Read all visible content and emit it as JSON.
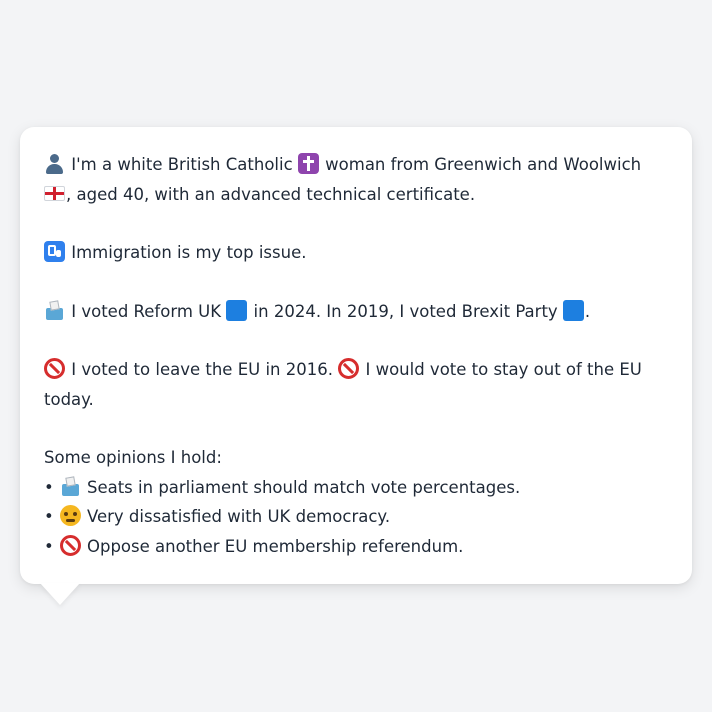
{
  "profile": {
    "intro": {
      "icon": "person-icon",
      "text_1": " I'm a white British Catholic ",
      "icon_religion": "latin-cross-icon",
      "text_2": " woman from Greenwich and Woolwich ",
      "icon_flag": "england-flag-icon",
      "text_3": ", aged 40, with an advanced technical certificate."
    },
    "top_issue": {
      "icon": "passport-control-icon",
      "text": " Immigration is my top issue."
    },
    "votes": {
      "icon": "ballot-box-icon",
      "text_1": " I voted Reform UK ",
      "icon_party_2024": "blue-square-icon",
      "text_2": " in 2024. In 2019, I voted Brexit Party ",
      "icon_party_2019": "blue-square-icon",
      "text_3": "."
    },
    "eu": {
      "icon_1": "prohibited-icon",
      "text_1": " I voted to leave the EU in 2016. ",
      "icon_2": "prohibited-icon",
      "text_2": " I would vote to stay out of the EU today."
    },
    "opinions_heading": "Some opinions I hold:",
    "opinions": [
      {
        "bullet": "•",
        "icon": "ballot-box-icon",
        "text": " Seats in parliament should match vote percentages."
      },
      {
        "bullet": "•",
        "icon": "angry-face-icon",
        "text": " Very dissatisfied with UK democracy."
      },
      {
        "bullet": "•",
        "icon": "prohibited-icon",
        "text": " Oppose another EU membership referendum."
      }
    ]
  },
  "colors": {
    "background": "#f3f4f6",
    "bubble": "#ffffff",
    "text": "#1f2937",
    "reform_blue": "#1d7fe0"
  }
}
